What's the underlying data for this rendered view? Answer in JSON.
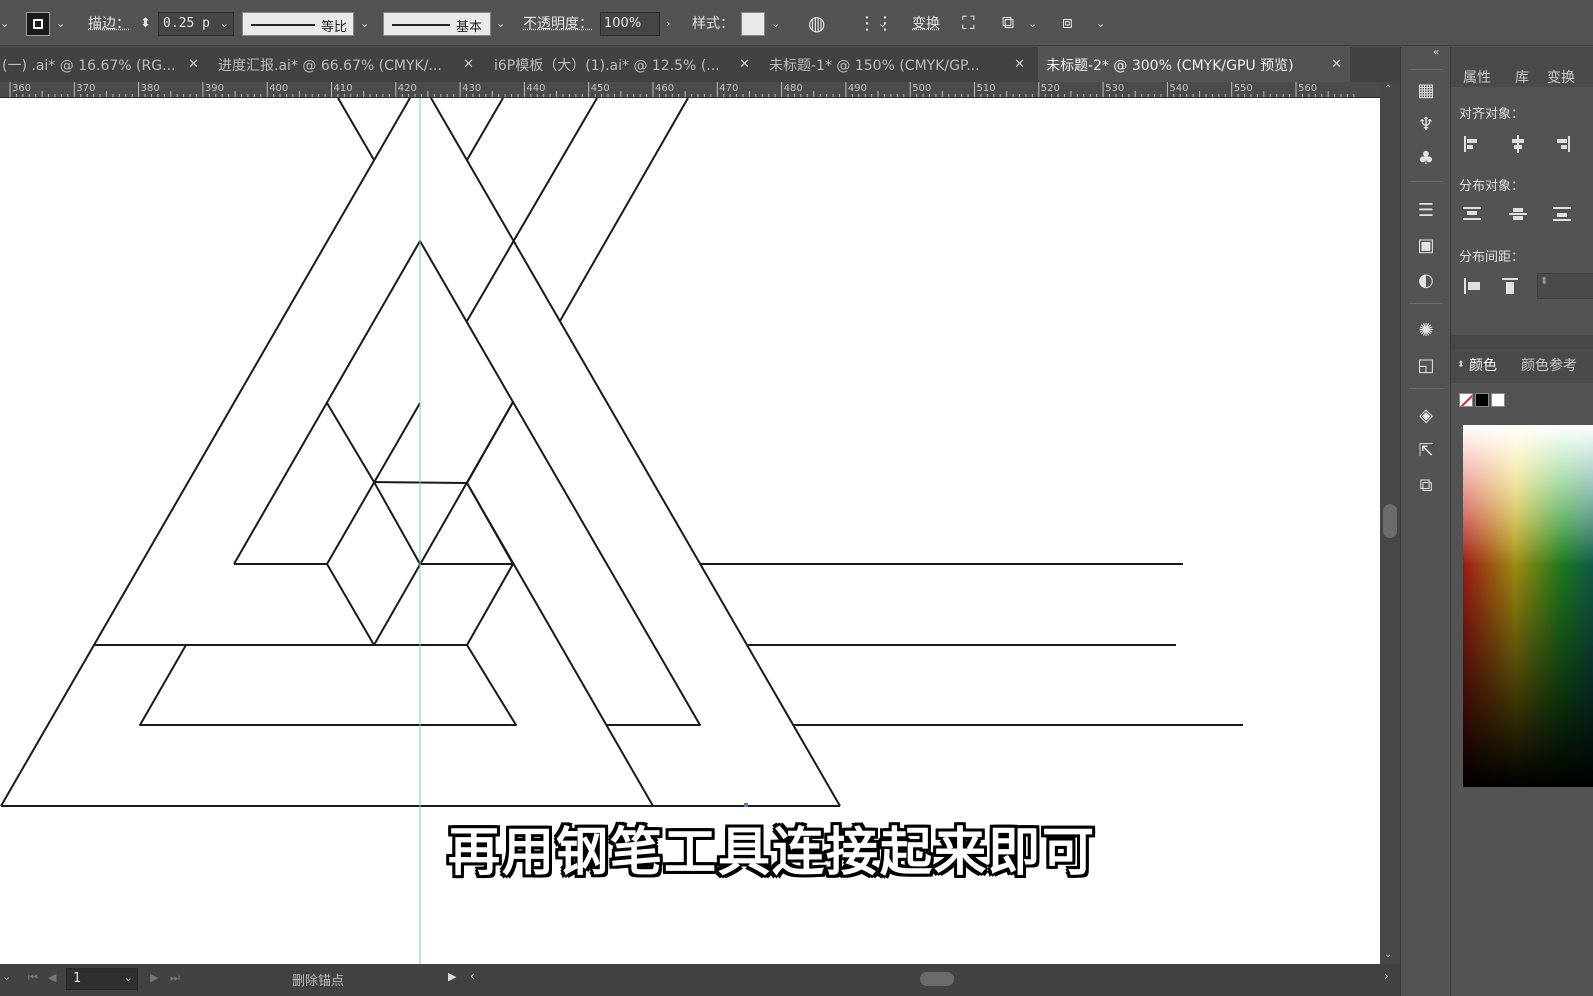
{
  "control_bar": {
    "stroke_label": "描边：",
    "stroke_value": "0.25 p",
    "profile_label": "等比",
    "brush_label": "基本",
    "opacity_label": "不透明度：",
    "opacity_value": "100%",
    "style_label": "样式：",
    "transform_label": "变换"
  },
  "tabs": [
    {
      "label": "(一) .ai* @ 16.67% (RG...",
      "active": false
    },
    {
      "label": "进度汇报.ai* @ 66.67% (CMYK/...",
      "active": false
    },
    {
      "label": "i6P模板（大）(1).ai* @ 12.5% (...",
      "active": false
    },
    {
      "label": "未标题-1* @ 150% (CMYK/GP...",
      "active": false
    },
    {
      "label": "未标题-2* @ 300% (CMYK/GPU 预览)",
      "active": true
    }
  ],
  "ruler": {
    "labels": [
      "360",
      "370",
      "380",
      "390",
      "400",
      "410",
      "420",
      "430",
      "440",
      "450",
      "460",
      "470",
      "480",
      "490",
      "500",
      "510",
      "520",
      "530",
      "540",
      "550",
      "560"
    ]
  },
  "subtitle": "再用钢笔工具连接起来即可",
  "status": {
    "page_number": "1",
    "action": "删除锚点"
  },
  "panel": {
    "tab_properties": "属性",
    "tab_library": "库",
    "tab_transform": "变换",
    "align_objects": "对齐对象：",
    "distribute_objects": "分布对象：",
    "distribute_spacing": "分布间距：",
    "color_tab": "颜色",
    "color_guide_tab": "颜色参考"
  },
  "colors": {
    "ui_bg": "#535353",
    "tab_bg": "#424242",
    "canvas": "#ffffff",
    "guide": "#6fd3c8",
    "stroke": "#1a1a1a"
  }
}
